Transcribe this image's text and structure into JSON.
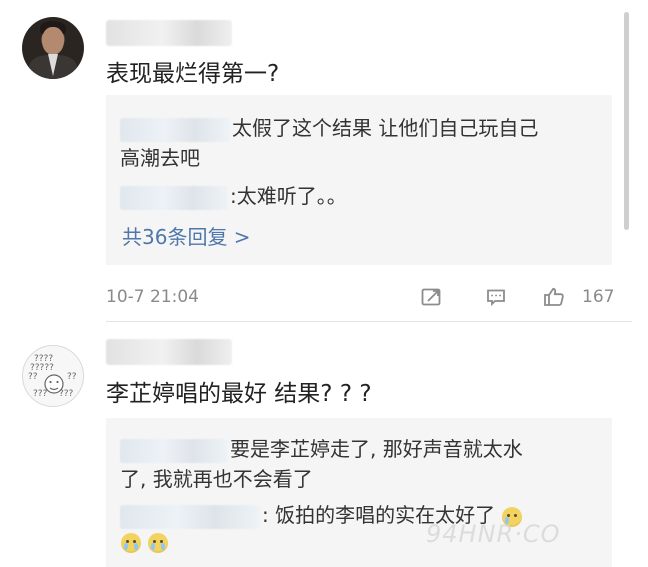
{
  "comments": [
    {
      "text": "表现最烂得第一?",
      "replies": [
        {
          "text_line1": "太假了这个结果 让他们自己玩自己",
          "text_line2": "高潮去吧"
        },
        {
          "text_line1": ":太难听了。。"
        }
      ],
      "more_replies_link": "共36条回复 >",
      "timestamp": "10-7 21:04",
      "like_count": "167"
    },
    {
      "text": "李芷婷唱的最好 结果? ? ?",
      "replies": [
        {
          "text_line1": "要是李芷婷走了, 那好声音就太水",
          "text_line2": "了, 我就再也不会看了"
        },
        {
          "text_line1": ": 饭拍的李唱的实在太好了"
        }
      ]
    }
  ],
  "icons": {
    "share": "share-icon",
    "comment": "comment-icon",
    "like": "thumbs-up-icon",
    "emoji": "crying-face-icon"
  },
  "colors": {
    "link": "#4f77ab",
    "meta": "#8a8a8a",
    "reply_bg": "#f5f5f5"
  },
  "watermark": "94HNR·CO"
}
